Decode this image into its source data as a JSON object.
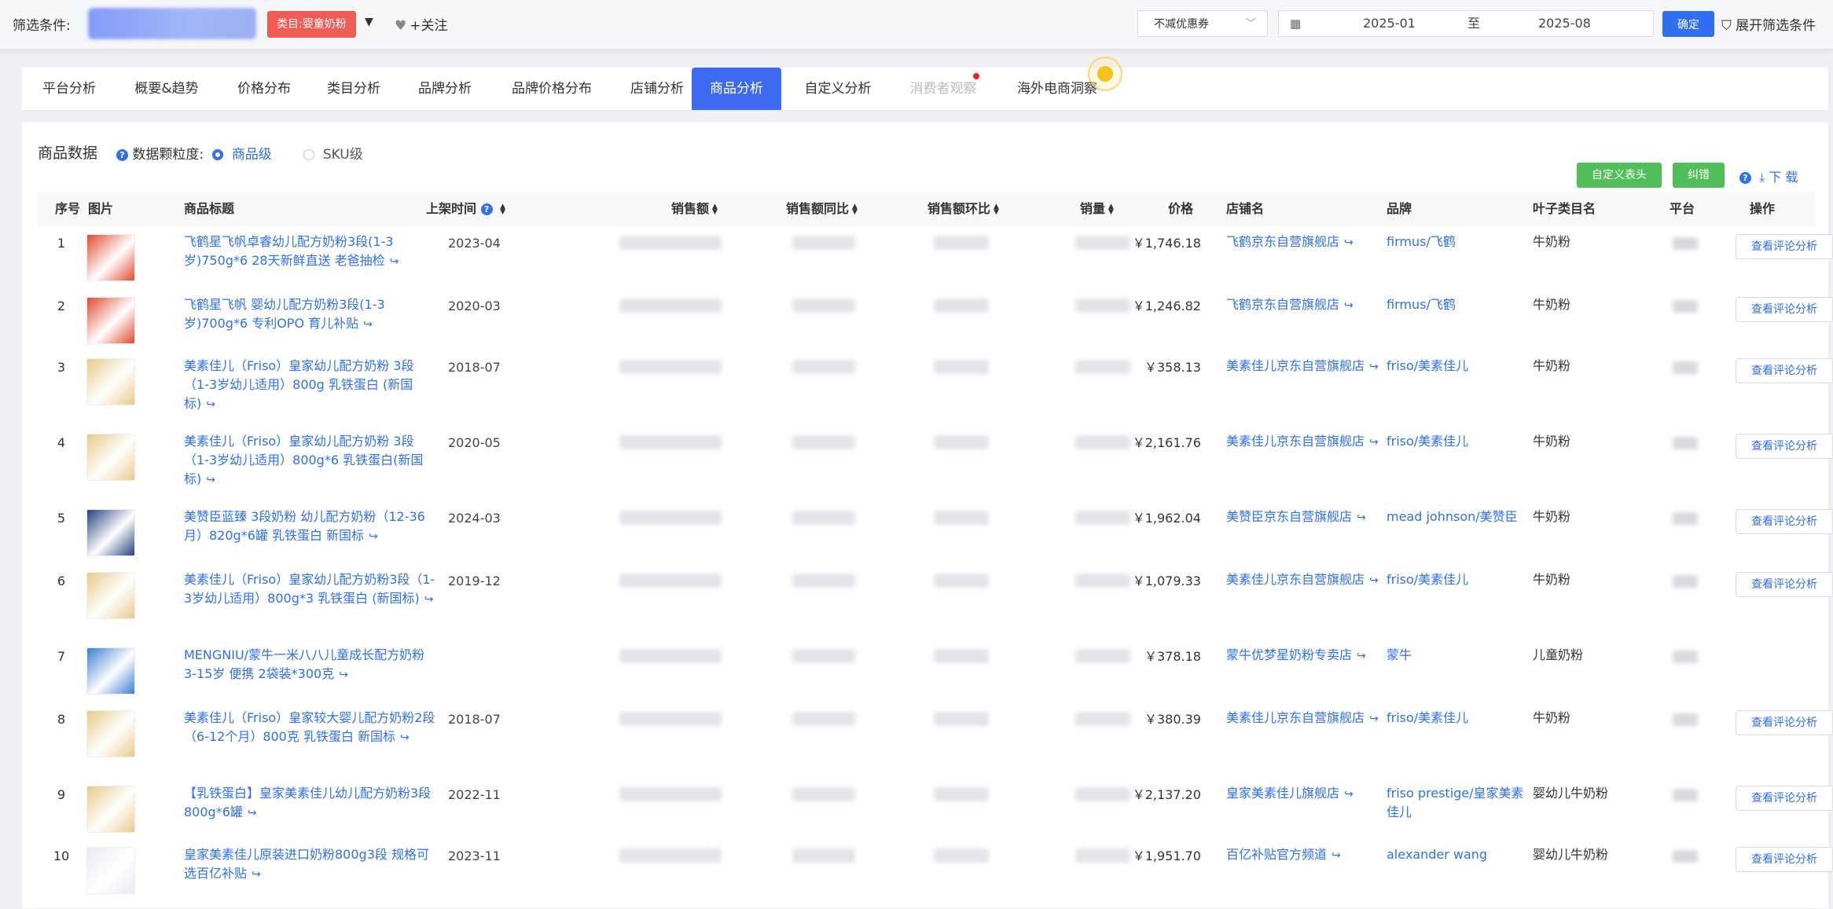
{
  "filter": {
    "label": "筛选条件:",
    "category_tag": "类目:婴童奶粉",
    "follow": "+关注",
    "coupon": "不减优惠券",
    "date_start": "2025-01",
    "date_to": "至",
    "date_end": "2025-08",
    "confirm": "确定",
    "expand": "展开筛选条件"
  },
  "tabs": [
    {
      "label": "平台分析"
    },
    {
      "label": "概要&趋势"
    },
    {
      "label": "价格分布"
    },
    {
      "label": "类目分析"
    },
    {
      "label": "品牌分析"
    },
    {
      "label": "品牌价格分布"
    },
    {
      "label": "店铺分析"
    },
    {
      "label": "商品分析"
    },
    {
      "label": "自定义分析"
    },
    {
      "label": "消费者观察"
    },
    {
      "label": "海外电商洞察"
    }
  ],
  "panel": {
    "title": "商品数据",
    "granularity_label": "数据颗粒度:",
    "option_product": "商品级",
    "option_sku": "SKU级",
    "custom_header": "自定义表头",
    "correct": "纠错",
    "download": "下 载"
  },
  "columns": {
    "idx": "序号",
    "image": "图片",
    "title": "商品标题",
    "launch": "上架时间",
    "sales": "销售额",
    "yoy": "销售额同比",
    "mom": "销售额环比",
    "volume": "销量",
    "price": "价格",
    "shop": "店铺名",
    "brand": "品牌",
    "leaf": "叶子类目名",
    "platform": "平台",
    "action": "操作"
  },
  "review_label": "查看评论分析",
  "rows": [
    {
      "idx": "1",
      "title": "飞鹤星飞帆卓睿幼儿配方奶粉3段(1-3岁)750g*6 28天新鲜直送 老爸抽检",
      "date": "2023-04",
      "price": "￥1,746.18",
      "shop": "飞鹤京东自营旗舰店",
      "brand": "firmus/飞鹤",
      "leaf": "牛奶粉",
      "review": true,
      "thumb": "red"
    },
    {
      "idx": "2",
      "title": "飞鹤星飞帆 婴幼儿配方奶粉3段(1-3岁)700g*6 专利OPO 育儿补贴",
      "date": "2020-03",
      "price": "￥1,246.82",
      "shop": "飞鹤京东自营旗舰店",
      "brand": "firmus/飞鹤",
      "leaf": "牛奶粉",
      "review": true,
      "thumb": "red"
    },
    {
      "idx": "3",
      "title": "美素佳儿（Friso）皇家幼儿配方奶粉 3段（1-3岁幼儿适用）800g 乳铁蛋白 (新国标)",
      "date": "2018-07",
      "price": "￥358.13",
      "shop": "美素佳儿京东自营旗舰店",
      "brand": "friso/美素佳儿",
      "leaf": "牛奶粉",
      "review": true,
      "thumb": "gold"
    },
    {
      "idx": "4",
      "title": "美素佳儿（Friso）皇家幼儿配方奶粉 3段（1-3岁幼儿适用）800g*6 乳铁蛋白(新国标)",
      "date": "2020-05",
      "price": "￥2,161.76",
      "shop": "美素佳儿京东自营旗舰店",
      "brand": "friso/美素佳儿",
      "leaf": "牛奶粉",
      "review": true,
      "thumb": "gold"
    },
    {
      "idx": "5",
      "title": "美赞臣蓝臻 3段奶粉 幼儿配方奶粉（12-36月）820g*6罐 乳铁蛋白 新国标",
      "date": "2024-03",
      "price": "￥1,962.04",
      "shop": "美赞臣京东自营旗舰店",
      "brand": "mead johnson/美赞臣",
      "leaf": "牛奶粉",
      "review": true,
      "thumb": "navy"
    },
    {
      "idx": "6",
      "title": "美素佳儿（Friso）皇家幼儿配方奶粉3段（1-3岁幼儿适用）800g*3 乳铁蛋白 (新国标)",
      "date": "2019-12",
      "price": "￥1,079.33",
      "shop": "美素佳儿京东自营旗舰店",
      "brand": "friso/美素佳儿",
      "leaf": "牛奶粉",
      "review": true,
      "thumb": "gold"
    },
    {
      "idx": "7",
      "title": "MENGNIU/蒙牛一米八八儿童成长配方奶粉3-15岁 便携 2袋装*300克",
      "date": "",
      "price": "￥378.18",
      "shop": "蒙牛优梦星奶粉专卖店",
      "brand": "蒙牛",
      "leaf": "儿童奶粉",
      "review": false,
      "thumb": "blue"
    },
    {
      "idx": "8",
      "title": "美素佳儿（Friso）皇家较大婴儿配方奶粉2段（6-12个月）800克 乳铁蛋白 新国标",
      "date": "2018-07",
      "price": "￥380.39",
      "shop": "美素佳儿京东自营旗舰店",
      "brand": "friso/美素佳儿",
      "leaf": "牛奶粉",
      "review": true,
      "thumb": "gold"
    },
    {
      "idx": "9",
      "title": "【乳铁蛋白】皇家美素佳儿幼儿配方奶粉3段800g*6罐",
      "date": "2022-11",
      "price": "￥2,137.20",
      "shop": "皇家美素佳儿旗舰店",
      "brand": "friso prestige/皇家美素佳儿",
      "leaf": "婴幼儿牛奶粉",
      "review": true,
      "thumb": "gold"
    },
    {
      "idx": "10",
      "title": "皇家美素佳儿原装进口奶粉800g3段 规格可选百亿补贴",
      "date": "2023-11",
      "price": "￥1,951.70",
      "shop": "百亿补贴官方频道",
      "brand": "alexander wang",
      "leaf": "婴幼儿牛奶粉",
      "review": true,
      "thumb": "white"
    }
  ],
  "thumb_colors": {
    "red": "#e04a2c",
    "gold": "#e9c98a",
    "navy": "#24407e",
    "blue": "#3a7fd0",
    "white": "#e8eaf0"
  },
  "accent": "#2f6ff0",
  "tag_red": "#ef5c54",
  "button_green": "#52be5a"
}
